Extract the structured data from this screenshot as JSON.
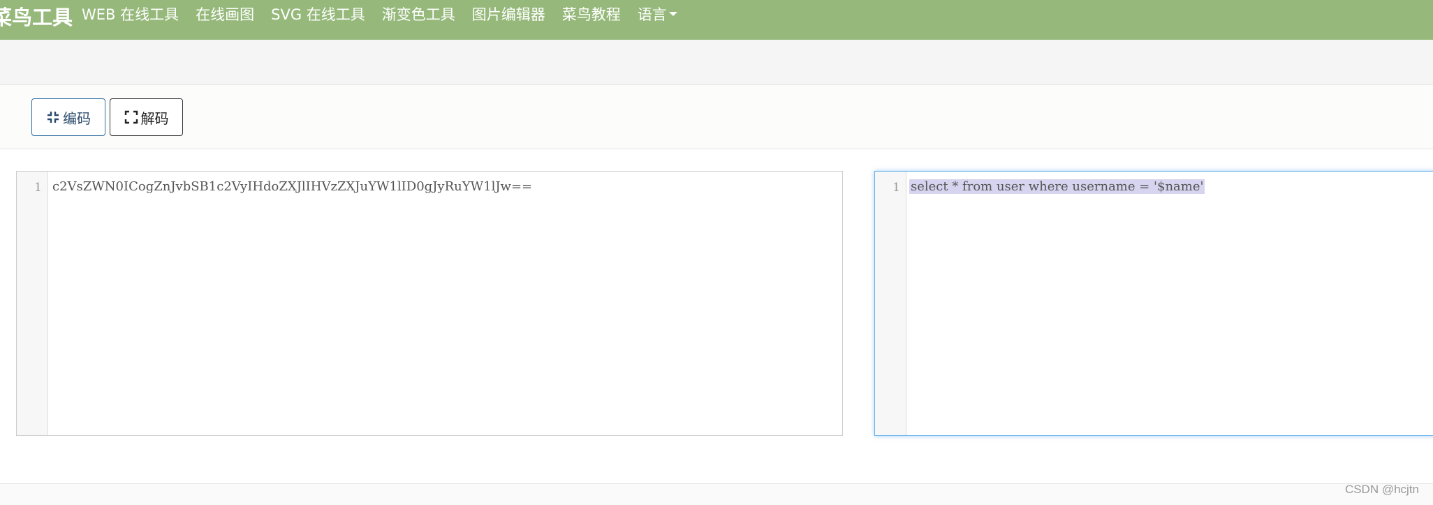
{
  "navbar": {
    "brand": "菜鸟工具",
    "items": [
      {
        "label": "WEB 在线工具"
      },
      {
        "label": "在线画图"
      },
      {
        "label": "SVG 在线工具"
      },
      {
        "label": "渐变色工具"
      },
      {
        "label": "图片编辑器"
      },
      {
        "label": "菜鸟教程"
      },
      {
        "label": "语言"
      }
    ]
  },
  "toolbar": {
    "encode_label": "编码",
    "decode_label": "解码"
  },
  "editors": {
    "left": {
      "line_number": "1",
      "content": "c2VsZWN0ICogZnJvbSB1c2VyIHdoZXJlIHVzZXJuYW1lID0gJyRuYW1lJw=="
    },
    "right": {
      "line_number": "1",
      "content": "select * from user where username = '$name'"
    }
  },
  "watermark": "CSDN @hcjtn",
  "colors": {
    "navbar_bg": "#96b97b",
    "selection": "#d7d4f0",
    "focus_border": "#66afe9"
  }
}
